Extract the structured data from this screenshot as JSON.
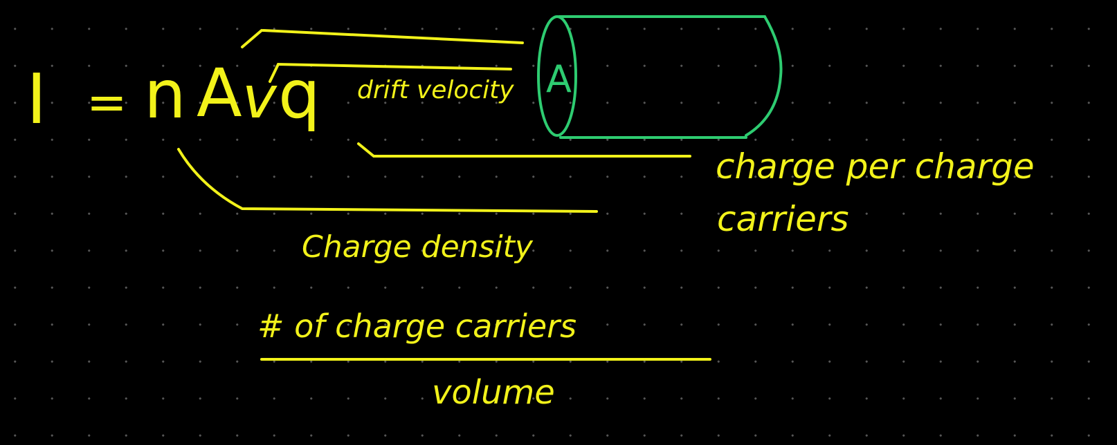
{
  "colors": {
    "background": "#000000",
    "grid_dot": "#555555",
    "ink_yellow": "#f2f21a",
    "ink_green": "#2ecc71"
  },
  "equation": {
    "current_symbol": "I",
    "equals": "=",
    "n": "n",
    "area": "A",
    "velocity": "v",
    "charge": "q"
  },
  "labels": {
    "drift_velocity": "drift velocity",
    "charge_per_carrier_line1": "charge per charge",
    "charge_per_carrier_line2": "carriers",
    "charge_density": "Charge density",
    "fraction_numerator": "# of charge carriers",
    "fraction_denominator": "volume"
  },
  "cylinder": {
    "face_label": "A"
  }
}
